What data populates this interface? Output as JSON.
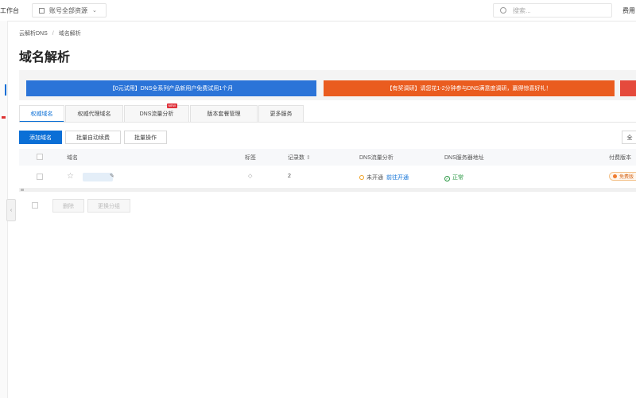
{
  "topbar": {
    "workbench": "工作台",
    "resource_select": "账号全部资源",
    "search_placeholder": "搜索...",
    "fee": "费用"
  },
  "breadcrumb": {
    "items": [
      "云解析DNS",
      "域名解析"
    ],
    "separator": "/"
  },
  "page_title": "域名解析",
  "banners": [
    {
      "text": "【0元试用】DNS全系列产品新用户免费试用1个月",
      "color": "#2b74d8"
    },
    {
      "text": "【有奖调研】请您花1-2分钟参与DNS满意度调研，赢得惊喜好礼！",
      "color": "#ea5c1f"
    }
  ],
  "tabs": [
    {
      "label": "权威域名",
      "active": true
    },
    {
      "label": "权威代理域名"
    },
    {
      "label": "DNS流量分析",
      "badge": "NEW"
    },
    {
      "label": "版本套餐管理"
    },
    {
      "label": "更多服务"
    }
  ],
  "toolbar": {
    "add_domain": "添加域名",
    "batch_renew": "批量自动续费",
    "batch_ops": "批量操作",
    "right_button": "全"
  },
  "table": {
    "headers": {
      "domain": "域名",
      "tag": "标签",
      "records": "记录数",
      "dns_traffic": "DNS流量分析",
      "dns_server": "DNS服务器地址",
      "plan": "付费版本"
    },
    "row": {
      "records": "2",
      "traffic_status": "未开通",
      "traffic_link": "前往开通",
      "server_status": "正常",
      "plan": "免费版"
    }
  },
  "footer": {
    "delete": "删除",
    "change_group": "更换分组"
  },
  "icons": {
    "star": "star-icon",
    "edit": "edit-icon",
    "tag": "tag-icon",
    "warning": "warning-circle-icon",
    "ok": "check-circle-icon",
    "search": "search-icon",
    "chevron": "chevron-down-icon"
  }
}
